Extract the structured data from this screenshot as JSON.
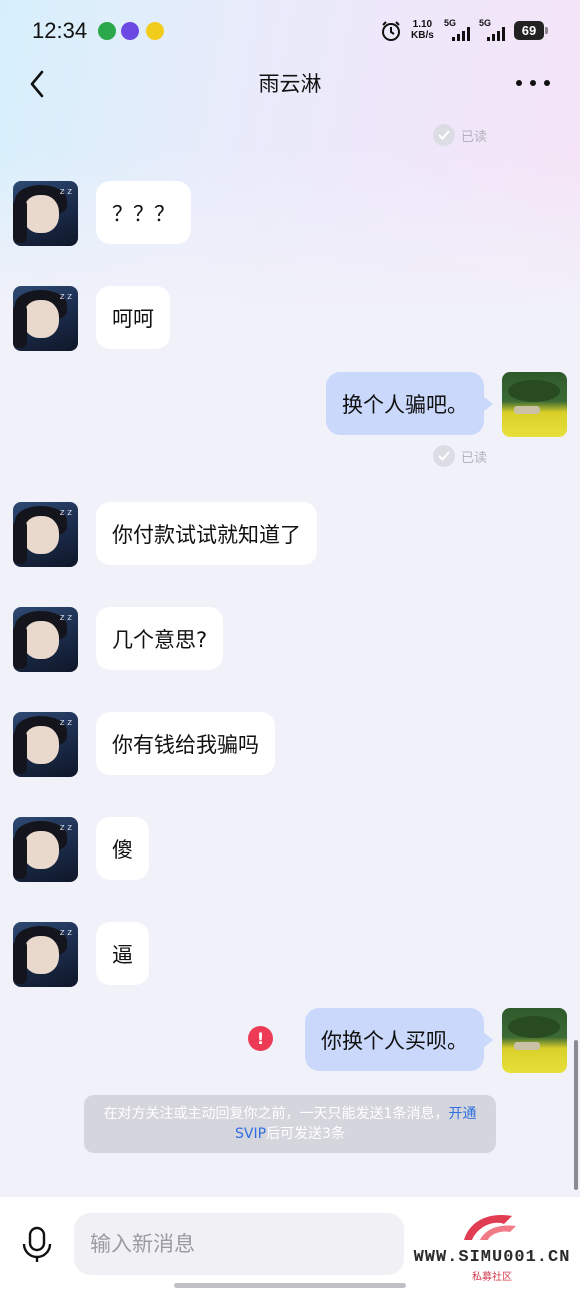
{
  "status_bar": {
    "time": "12:34",
    "net_speed_value": "1.10",
    "net_speed_unit": "KB/s",
    "sim1_label": "5G",
    "sim2_label": "5G",
    "battery": "69"
  },
  "header": {
    "title": "雨云淋"
  },
  "read_label": "已读",
  "messages": [
    {
      "from": "other",
      "text": "？？？"
    },
    {
      "from": "other",
      "text": "呵呵"
    },
    {
      "from": "me",
      "text": "换个人骗吧。"
    },
    {
      "from": "other",
      "text": "你付款试试就知道了"
    },
    {
      "from": "other",
      "text": "几个意思?"
    },
    {
      "from": "other",
      "text": "你有钱给我骗吗"
    },
    {
      "from": "other",
      "text": "傻"
    },
    {
      "from": "other",
      "text": "逼"
    },
    {
      "from": "me",
      "text": "你换个人买呗。"
    }
  ],
  "error_mark": "!",
  "notice": {
    "text_before": "在对方关注或主动回复你之前，一天只能发送1条消息，",
    "link": "开通SVIP",
    "text_after": "后可发送3条"
  },
  "input": {
    "placeholder": "输入新消息"
  },
  "watermark": {
    "text": "WWW.SIMU001.CN",
    "subtitle": "私募社区"
  },
  "colors": {
    "outgoing_bubble": "#c9d8fb",
    "incoming_bubble": "#ffffff",
    "error": "#ee3b55",
    "link": "#2f6fe0"
  }
}
